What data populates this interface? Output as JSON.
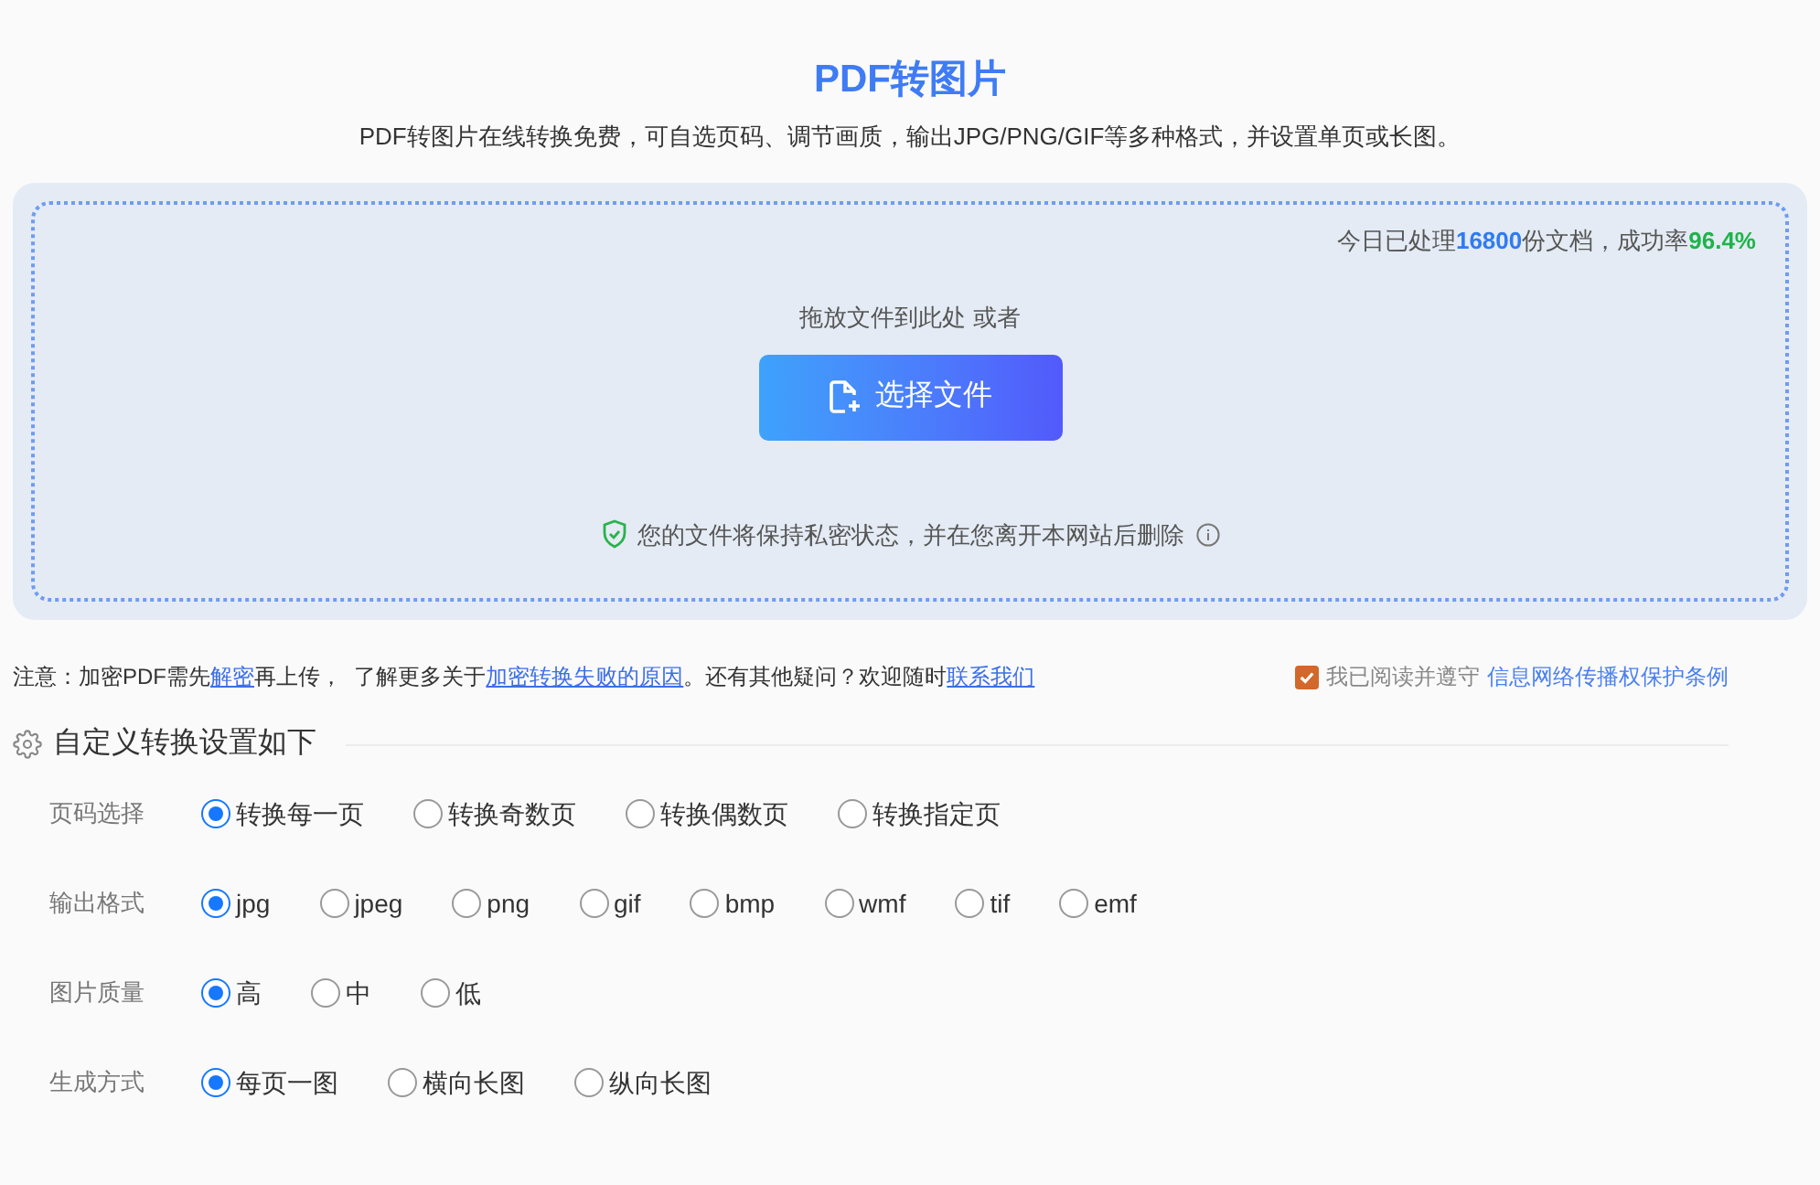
{
  "header": {
    "title": "PDF转图片",
    "subtitle": "PDF转图片在线转换免费，可自选页码、调节画质，输出JPG/PNG/GIF等多种格式，并设置单页或长图。"
  },
  "upload": {
    "stats": [
      {
        "kind": "text",
        "text": "今日已处理"
      },
      {
        "kind": "count",
        "text": "16800"
      },
      {
        "kind": "text",
        "text": "份文档，成功率"
      },
      {
        "kind": "rate",
        "text": "96.4%"
      }
    ],
    "drop_hint": "拖放文件到此处 或者",
    "button": "选择文件",
    "privacy": "您的文件将保持私密状态，并在您离开本网站后删除"
  },
  "notice": [
    {
      "kind": "text",
      "text": "注意：加密PDF需先"
    },
    {
      "kind": "link",
      "text": "解密"
    },
    {
      "kind": "text",
      "text": "再上传，  了解更多关于"
    },
    {
      "kind": "link",
      "text": "加密转换失败的原因"
    },
    {
      "kind": "text",
      "text": "。还有其他疑问？欢迎随时"
    },
    {
      "kind": "link",
      "text": "联系我们"
    }
  ],
  "agreement": {
    "checked": true,
    "text": "我已阅读并遵守",
    "link": "信息网络传播权保护条例"
  },
  "settings": {
    "title": "自定义转换设置如下",
    "groups": [
      {
        "label": "页码选择",
        "options": [
          {
            "label": "转换每一页",
            "selected": true
          },
          {
            "label": "转换奇数页",
            "selected": false
          },
          {
            "label": "转换偶数页",
            "selected": false
          },
          {
            "label": "转换指定页",
            "selected": false
          }
        ]
      },
      {
        "label": "输出格式",
        "options": [
          {
            "label": "jpg",
            "selected": true
          },
          {
            "label": "jpeg",
            "selected": false
          },
          {
            "label": "png",
            "selected": false
          },
          {
            "label": "gif",
            "selected": false
          },
          {
            "label": "bmp",
            "selected": false
          },
          {
            "label": "wmf",
            "selected": false
          },
          {
            "label": "tif",
            "selected": false
          },
          {
            "label": "emf",
            "selected": false
          }
        ]
      },
      {
        "label": "图片质量",
        "options": [
          {
            "label": "高",
            "selected": true
          },
          {
            "label": "中",
            "selected": false
          },
          {
            "label": "低",
            "selected": false
          }
        ]
      },
      {
        "label": "生成方式",
        "options": [
          {
            "label": "每页一图",
            "selected": true
          },
          {
            "label": "横向长图",
            "selected": false
          },
          {
            "label": "纵向长图",
            "selected": false
          }
        ]
      }
    ]
  }
}
